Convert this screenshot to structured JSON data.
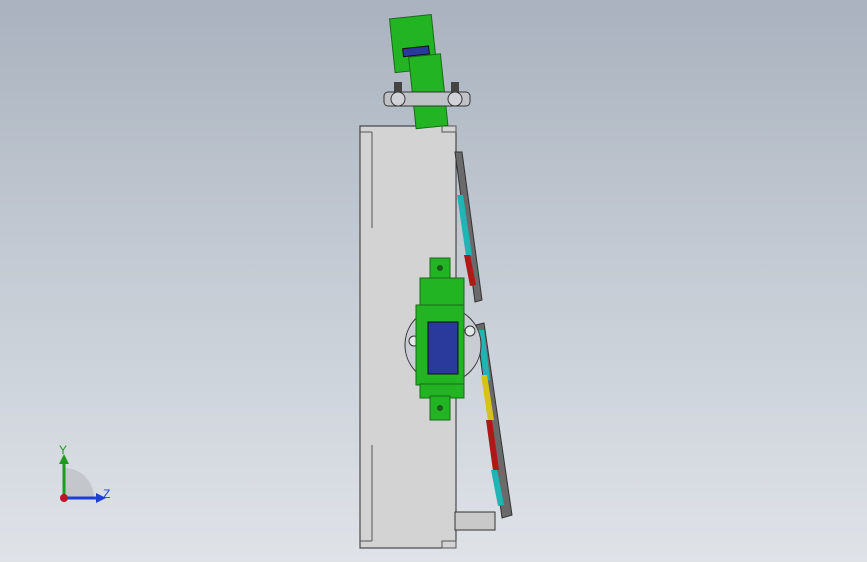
{
  "viewport": {
    "background_top": "#a9b2be",
    "background_bottom": "#dfe3e8"
  },
  "model": {
    "body_color": "#d3d3d3",
    "bracket_color": "#22b422",
    "sensor_color": "#2a3a9c",
    "edge_color": "#2b2b2b"
  },
  "triad": {
    "y_label": "Y",
    "z_label": "Z",
    "y_color": "#1f9a1f",
    "z_color": "#1f3fd1",
    "x_color": "#c0102a"
  }
}
